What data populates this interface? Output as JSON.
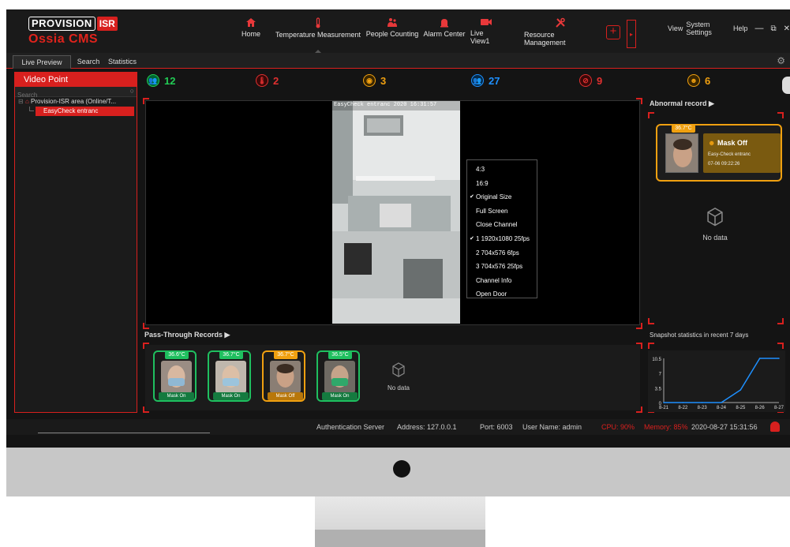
{
  "app": {
    "logo_top": "PROVISION",
    "logo_isr": "ISR",
    "logo_name": "Ossia CMS",
    "window_menu": [
      "View",
      "System Settings",
      "Help"
    ]
  },
  "nav": [
    {
      "label": "Home",
      "icon": "home-icon"
    },
    {
      "label": "Temperature Measurement",
      "icon": "thermometer-icon"
    },
    {
      "label": "People Counting",
      "icon": "people-counting-icon"
    },
    {
      "label": "Alarm Center",
      "icon": "alarm-icon"
    },
    {
      "label": "Live View1",
      "icon": "camera-icon"
    },
    {
      "label": "Resource Management",
      "icon": "tools-icon"
    }
  ],
  "tabs": [
    "Live Preview",
    "Search",
    "Statistics"
  ],
  "left_panel": {
    "header": "Video Point",
    "search_placeholder": "Search",
    "tree_root": "Provision-ISR area (Online/T...",
    "tree_child": "EasyCheck entranc"
  },
  "stats": [
    {
      "value": "12",
      "icon": "people-icon",
      "color": "#22cc55"
    },
    {
      "value": "2",
      "icon": "thermometer-icon",
      "color": "#e03030"
    },
    {
      "value": "3",
      "icon": "no-mask-icon",
      "color": "#f0a010"
    },
    {
      "value": "27",
      "icon": "people-icon",
      "color": "#1e90ff"
    },
    {
      "value": "9",
      "icon": "mask-icon",
      "color": "#e03030"
    },
    {
      "value": "6",
      "icon": "mask-face-icon",
      "color": "#f0a010"
    }
  ],
  "video": {
    "overlay_text": "EasyCheck entranc  2020 16:31:57"
  },
  "context_menu": [
    {
      "label": "4:3",
      "checked": false
    },
    {
      "label": "16:9",
      "checked": false
    },
    {
      "label": "Original Size",
      "checked": true
    },
    {
      "label": "Full Screen",
      "checked": false
    },
    {
      "label": "Close Channel",
      "checked": false
    },
    {
      "label": "1 1920x1080 25fps",
      "checked": true
    },
    {
      "label": "2 704x576 6fps",
      "checked": false
    },
    {
      "label": "3 704x576 25fps",
      "checked": false
    },
    {
      "label": "Channel Info",
      "checked": false
    },
    {
      "label": "Open Door",
      "checked": false
    }
  ],
  "pass_through": {
    "title": "Pass-Through Records",
    "no_data": "No data",
    "cards": [
      {
        "temp": "36.6°C",
        "mask": "Mask On",
        "color": "#1fbf5f"
      },
      {
        "temp": "36.7°C",
        "mask": "Mask On",
        "color": "#1fbf5f"
      },
      {
        "temp": "36.7°C",
        "mask": "Mask Off",
        "color": "#f0a010"
      },
      {
        "temp": "36.5°C",
        "mask": "Mask On",
        "color": "#1fbf5f"
      }
    ]
  },
  "abnormal": {
    "title": "Abnormal record",
    "temp": "36.7°C",
    "status": "Mask Off",
    "location": "Easy-Check entranc",
    "time": "07-06 09:22:26",
    "no_data": "No data"
  },
  "snapshot": {
    "title": "Snapshot statistics in recent 7 days"
  },
  "chart_data": {
    "type": "line",
    "title": "Snapshot statistics in recent 7 days",
    "categories": [
      "8-21",
      "8-22",
      "8-23",
      "8-24",
      "8-25",
      "8-26",
      "8-27"
    ],
    "values": [
      0,
      0,
      0,
      0,
      3,
      10.5,
      10.5
    ],
    "yticks": [
      "0",
      "3.5",
      "7",
      "10.5"
    ],
    "ylim": [
      0,
      10.5
    ],
    "color": "#1e90ff"
  },
  "status_bar": {
    "auth": "Authentication Server",
    "address": "Address: 127.0.0.1",
    "port": "Port: 6003",
    "user": "User Name: admin",
    "cpu": "CPU: 90%",
    "memory": "Memory: 85%",
    "datetime": "2020-08-27 15:31:56"
  }
}
